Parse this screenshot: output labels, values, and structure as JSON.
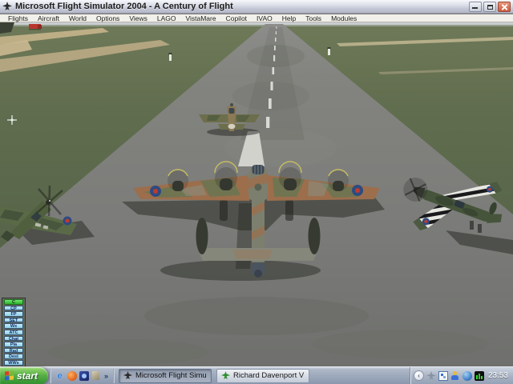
{
  "window": {
    "title": "Microsoft Flight Simulator 2004 - A Century of Flight"
  },
  "menu": {
    "items": [
      "Flights",
      "Aircraft",
      "World",
      "Options",
      "Views",
      "LAGO",
      "VistaMare",
      "Copilot",
      "IVAO",
      "Help",
      "Tools",
      "Modules"
    ]
  },
  "ivao_panel": {
    "buttons": [
      "C",
      "CP",
      "FP",
      "SET",
      "Wx",
      "ATC",
      "Chat",
      "Pla",
      "Rad",
      "Dest",
      "WWs"
    ]
  },
  "scene": {
    "description": "Runway view: Lancaster bomber center, fighter ahead on centerline, Spitfire left edge, Spitfire with invasion stripes right, fire truck on far left grass",
    "colors": {
      "grass": "#5e6b4e",
      "runway": "#7f807e",
      "horizon_haze": "#c9ced2",
      "taxiway": "#c6b48c",
      "marking": "#e2e2de",
      "camo_brown": "#9c6e4c",
      "camo_green": "#6d7452",
      "roundel_blue": "#2d4b82",
      "roundel_red": "#bf3a2b"
    }
  },
  "taskbar": {
    "start_label": "start",
    "quick_launch": {
      "ie_glyph": "e",
      "overflow_glyph": "»"
    },
    "tasks": [
      {
        "label": "Microsoft Flight Simul...",
        "active": true
      },
      {
        "label": "Richard Davenport VL...",
        "active": false
      }
    ],
    "tray": {
      "collapse_glyph": "‹",
      "clock": "23:53"
    }
  }
}
